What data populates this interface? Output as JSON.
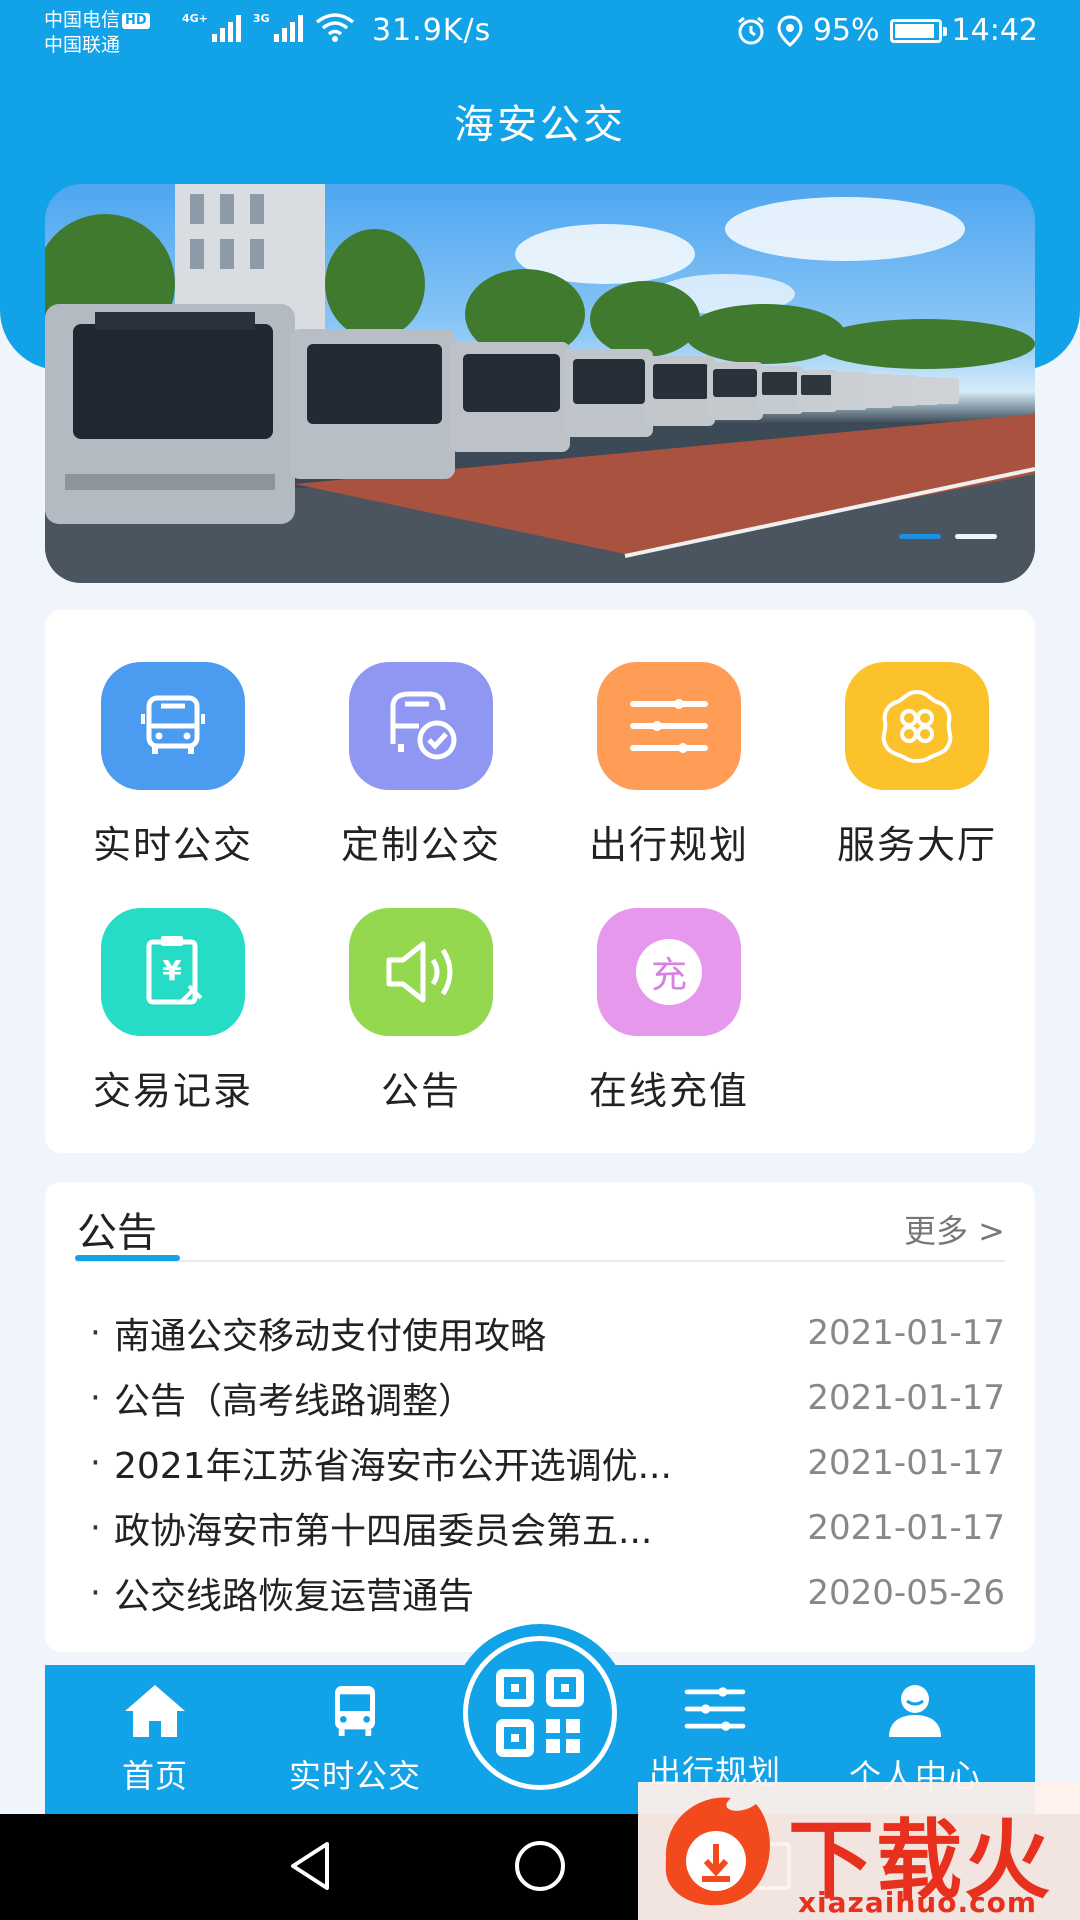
{
  "status_bar": {
    "carrier1": "中国电信",
    "hd": "HD",
    "carrier2": "中国联通",
    "net1": "4G+",
    "net2": "3G",
    "speed": "31.9K/s",
    "battery": "95%",
    "battery_level": 0.95,
    "time": "14:42"
  },
  "header": {
    "title": "海安公交"
  },
  "banner": {
    "slide_count": 2,
    "active_index": 0
  },
  "menu": {
    "items": [
      {
        "label": "实时公交",
        "icon": "bus-icon",
        "color": "#4b9bf0"
      },
      {
        "label": "定制公交",
        "icon": "custom-bus-icon",
        "color": "#8f97f2"
      },
      {
        "label": "出行规划",
        "icon": "sliders-icon",
        "color": "#ff9d57"
      },
      {
        "label": "服务大厅",
        "icon": "clover-icon",
        "color": "#fcc22c"
      },
      {
        "label": "交易记录",
        "icon": "receipt-icon",
        "color": "#26dcc6"
      },
      {
        "label": "公告",
        "icon": "speaker-icon",
        "color": "#93d84e"
      },
      {
        "label": "在线充值",
        "icon": "recharge-icon",
        "icon_text": "充",
        "color": "#e598ec"
      }
    ]
  },
  "notices": {
    "title": "公告",
    "more": "更多 >",
    "items": [
      {
        "text": "南通公交移动支付使用攻略",
        "date": "2021-01-17"
      },
      {
        "text": "公告（高考线路调整）",
        "date": "2021-01-17"
      },
      {
        "text": "2021年江苏省海安市公开选调优...",
        "date": "2021-01-17"
      },
      {
        "text": "政协海安市第十四届委员会第五...",
        "date": "2021-01-17"
      },
      {
        "text": "公交线路恢复运营通告",
        "date": "2020-05-26"
      }
    ]
  },
  "bottom_nav": {
    "items": [
      {
        "label": "首页",
        "icon": "home-icon"
      },
      {
        "label": "实时公交",
        "icon": "bus-icon"
      },
      {
        "label": "",
        "icon": "qr-code-icon"
      },
      {
        "label": "出行规划",
        "icon": "sliders-icon"
      },
      {
        "label": "个人中心",
        "icon": "user-icon"
      }
    ]
  },
  "watermark": {
    "text": "下载火",
    "sub": "xiazaihuo.com"
  },
  "colors": {
    "primary": "#12a2e8",
    "background": "#f0f5fb"
  }
}
